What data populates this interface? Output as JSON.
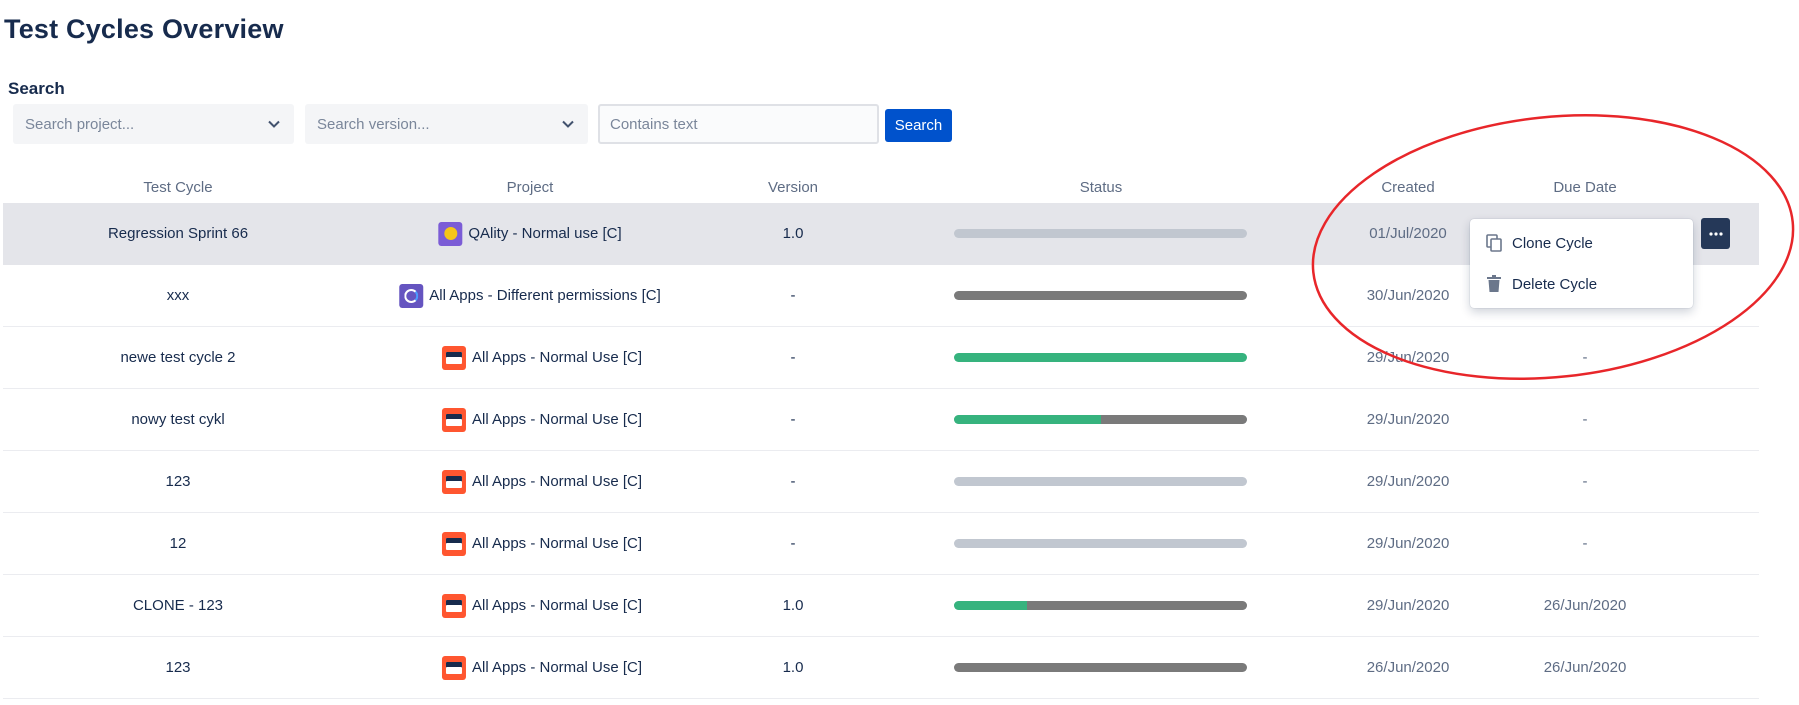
{
  "page": {
    "title": "Test Cycles Overview"
  },
  "search": {
    "label": "Search",
    "project_placeholder": "Search project...",
    "version_placeholder": "Search version...",
    "text_placeholder": "Contains text",
    "button_label": "Search"
  },
  "table": {
    "columns": {
      "test_cycle": "Test Cycle",
      "project": "Project",
      "version": "Version",
      "status": "Status",
      "created": "Created",
      "due_date": "Due Date"
    },
    "rows": [
      {
        "name": "Regression Sprint 66",
        "project": "QAlity - Normal use [C]",
        "project_icon": "qality-logo-icon",
        "version": "1.0",
        "status": [
          {
            "label": "not-executed",
            "value": 1.0,
            "color": "#c1c7d0"
          }
        ],
        "created": "01/Jul/2020",
        "due": ""
      },
      {
        "name": "xxx",
        "project": "All Apps - Different permissions [C]",
        "project_icon": "allapps-diff-logo-icon",
        "version": "-",
        "status": [
          {
            "label": "in-progress",
            "value": 1.0,
            "color": "#7a7a7a"
          }
        ],
        "created": "30/Jun/2020",
        "due": ""
      },
      {
        "name": "newe test cycle 2",
        "project": "All Apps - Normal Use [C]",
        "project_icon": "allapps-logo-icon",
        "version": "-",
        "status": [
          {
            "label": "passed",
            "value": 1.0,
            "color": "#36b37e"
          }
        ],
        "created": "29/Jun/2020",
        "due": "-"
      },
      {
        "name": "nowy test cykl",
        "project": "All Apps - Normal Use [C]",
        "project_icon": "allapps-logo-icon",
        "version": "-",
        "status": [
          {
            "label": "passed",
            "value": 0.5,
            "color": "#36b37e"
          },
          {
            "label": "in-progress",
            "value": 0.5,
            "color": "#7a7a7a"
          }
        ],
        "created": "29/Jun/2020",
        "due": "-"
      },
      {
        "name": "123",
        "project": "All Apps - Normal Use [C]",
        "project_icon": "allapps-logo-icon",
        "version": "-",
        "status": [
          {
            "label": "not-executed",
            "value": 1.0,
            "color": "#c1c7d0"
          }
        ],
        "created": "29/Jun/2020",
        "due": "-"
      },
      {
        "name": "12",
        "project": "All Apps - Normal Use [C]",
        "project_icon": "allapps-logo-icon",
        "version": "-",
        "status": [
          {
            "label": "not-executed",
            "value": 1.0,
            "color": "#c1c7d0"
          }
        ],
        "created": "29/Jun/2020",
        "due": "-"
      },
      {
        "name": "CLONE - 123",
        "project": "All Apps - Normal Use [C]",
        "project_icon": "allapps-logo-icon",
        "version": "1.0",
        "status": [
          {
            "label": "passed",
            "value": 0.25,
            "color": "#36b37e"
          },
          {
            "label": "in-progress",
            "value": 0.75,
            "color": "#7a7a7a"
          }
        ],
        "created": "29/Jun/2020",
        "due": "26/Jun/2020"
      },
      {
        "name": "123",
        "project": "All Apps - Normal Use [C]",
        "project_icon": "allapps-logo-icon",
        "version": "1.0",
        "status": [
          {
            "label": "in-progress",
            "value": 1.0,
            "color": "#7a7a7a"
          }
        ],
        "created": "26/Jun/2020",
        "due": "26/Jun/2020"
      }
    ]
  },
  "row_menu": {
    "trigger_icon": "more-actions-icon",
    "items": [
      {
        "label": "Clone Cycle",
        "icon": "copy-icon"
      },
      {
        "label": "Delete Cycle",
        "icon": "trash-icon"
      }
    ]
  },
  "annotation": {
    "color": "#e8262a",
    "shape": "ellipse"
  }
}
